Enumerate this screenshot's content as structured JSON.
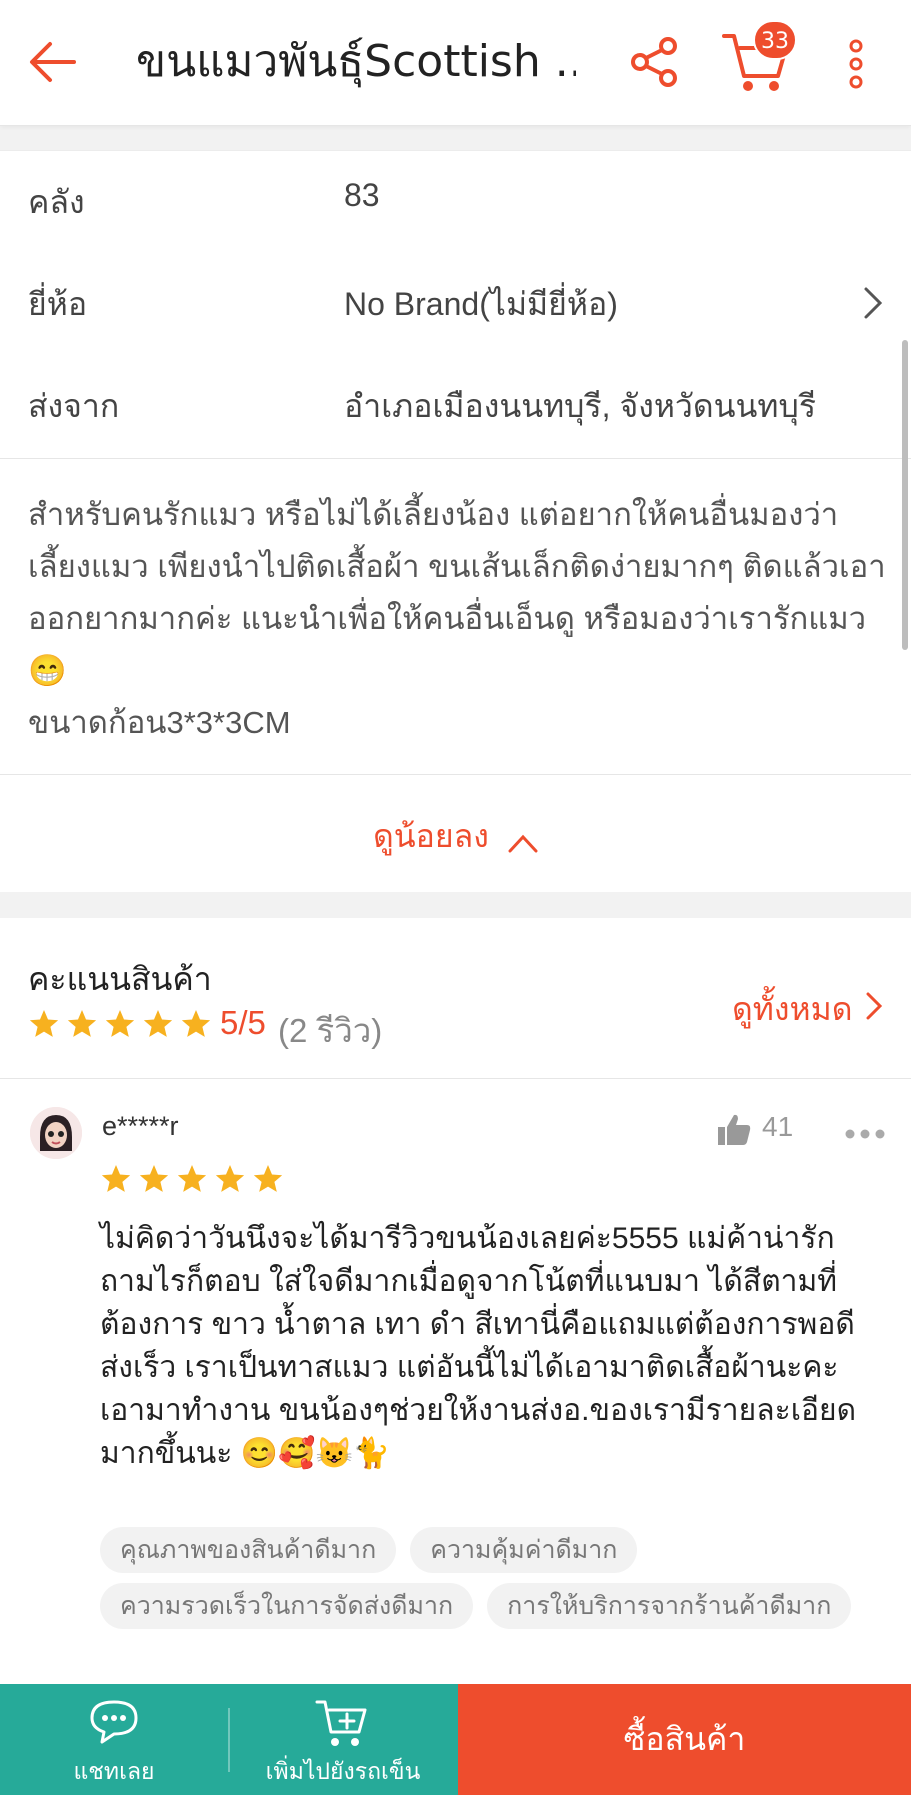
{
  "colors": {
    "accent": "#ee4d2d",
    "teal": "#26aa99",
    "star": "#f7b11f"
  },
  "header": {
    "title": "ขนแมวพันธุ์Scottish ...",
    "cart_count": "33",
    "icons": [
      "back-arrow-icon",
      "share-icon",
      "cart-icon",
      "more-vertical-icon"
    ]
  },
  "specs": [
    {
      "label": "คลัง",
      "value": "83"
    },
    {
      "label": "ยี่ห้อ",
      "value": "No Brand(ไม่มียี่ห้อ)"
    },
    {
      "label": "ส่งจาก",
      "value": "อำเภอเมืองนนทบุรี, จังหวัดนนทบุรี"
    }
  ],
  "description": {
    "text": "สำหรับคนรักแมว หรือไม่ได้เลี้ยงน้อง แต่อยากให้คนอื่นมองว่าเลี้ยงแมว เพียงนำไปติดเสื้อผ้า ขนเส้นเล็กติดง่ายมากๆ ติดแล้วเอาออกยากมากค่ะ แนะนำเพื่อให้คนอื่นเอ็นดู หรือมองว่าเรารักแมว😁",
    "size_line": "ขนาดก้อน3*3*3CM",
    "collapse_label": "ดูน้อยลง"
  },
  "rating": {
    "heading": "คะแนนสินค้า",
    "stars": 5,
    "score": "5/5",
    "count": "(2 รีวิว)",
    "see_all": "ดูทั้งหมด"
  },
  "review": {
    "reviewer": "e*****r",
    "likes": "41",
    "stars": 5,
    "text": "ไม่คิดว่าวันนึงจะได้มารีวิวขนน้องเลยค่ะ5555 แม่ค้าน่ารัก ถามไรก็ตอบ ใส่ใจดีมากเมื่อดูจากโน้ตที่แนบมา ได้สีตามที่ต้องการ ขาว น้ำตาล เทา ดำ สีเทานี่คือแถมแต่ต้องการพอดี ส่งเร็ว เราเป็นทาสแมว แต่อันนี้ไม่ได้เอามาติดเสื้อผ้านะคะ เอามาทำงาน ขนน้องๆช่วยให้งานส่งอ.ของเรามีรายละเอียดมากขึ้นนะ 😊🥰😺🐈",
    "tags": [
      "คุณภาพของสินค้าดีมาก",
      "ความคุ้มค่าดีมาก",
      "ความรวดเร็วในการจัดส่งดีมาก",
      "การให้บริการจากร้านค้าดีมาก"
    ]
  },
  "bottom_bar": {
    "chat_label": "แชทเลย",
    "add_to_cart_label": "เพิ่มไปยังรถเข็น",
    "buy_label": "ซื้อสินค้า"
  }
}
